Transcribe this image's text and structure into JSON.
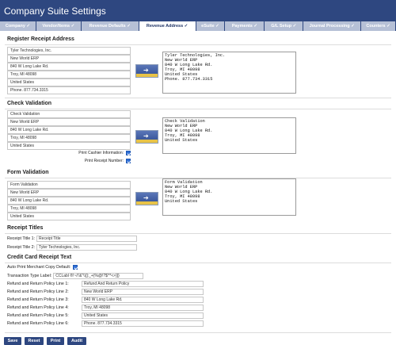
{
  "app": {
    "title": "Company Suite Settings"
  },
  "tabs": [
    {
      "label": "Company ✓"
    },
    {
      "label": "Vendor/Items ✓"
    },
    {
      "label": "Revenue Defaults ✓"
    },
    {
      "label": "Revenue Address ✓",
      "active": true
    },
    {
      "label": "eSuite ✓"
    },
    {
      "label": "Payments ✓"
    },
    {
      "label": "G/L Setup ✓"
    },
    {
      "label": "Journal Processing ✓"
    },
    {
      "label": "Counters ✓"
    }
  ],
  "register": {
    "title": "Register Receipt Address",
    "fields": [
      "Tyler Technologies, Inc.",
      "New World ERP",
      "840 W Long Lake Rd.",
      "Troy, MI 48098",
      "United States",
      "Phone. 877.734.3315"
    ],
    "preview": "Tyler Technologies, Inc.\nNew World ERP\n840 W Long Lake Rd.\nTroy, MI 48098\nUnited States\nPhone. 877.734.3315"
  },
  "check": {
    "title": "Check Validation",
    "fields": [
      "Check Validation",
      "New World ERP",
      "840 W Long Lake Rd.",
      "Troy, MI 48098",
      "United States"
    ],
    "preview": "Check Validation\nNew World ERP\n840 W Long Lake Rd.\nTroy, MI 48098\nUnited States",
    "print_cashier_label": "Print Cashier Information:",
    "print_receipt_label": "Print Receipt Number:"
  },
  "form": {
    "title": "Form Validation",
    "fields": [
      "Form Validation",
      "New World ERP",
      "840 W Long Lake Rd.",
      "Troy, MI 48098",
      "United States"
    ],
    "preview": "Form Validation\nNew World ERP\n840 W Long Lake Rd.\nTroy, MI 48098\nUnited States"
  },
  "receipt_titles": {
    "title": "Receipt Titles",
    "label1": "Receipt Title 1:",
    "value1": "Receipt Title",
    "label2": "Receipt Title 2:",
    "value2": "Tyler Technologies, Inc."
  },
  "credit_card": {
    "title": "Credit Card Receipt Text",
    "auto_print_label": "Auto Print Merchant Copy Default:",
    "transaction_label": "Transaction Type Label:",
    "transaction_value": "CCLabl ®!~/\\'&\"\\\\[]:_+{%@!?$^*<>}]}",
    "policy_lines": [
      {
        "label": "Refund and Return Policy Line 1:",
        "value": "Refund And Return Policy"
      },
      {
        "label": "Refund and Return Policy Line 2:",
        "value": "New World ERP"
      },
      {
        "label": "Refund and Return Policy Line 3:",
        "value": "840 W Long Lake Rd."
      },
      {
        "label": "Refund and Return Policy Line 4:",
        "value": "Troy, MI 48098"
      },
      {
        "label": "Refund and Return Policy Line 5:",
        "value": "United States"
      },
      {
        "label": "Refund and Return Policy Line 6:",
        "value": "Phone. 877.734.3315"
      }
    ]
  },
  "buttons": {
    "save": "Save",
    "reset": "Reset",
    "print": "Print",
    "audit": "Audit"
  },
  "icons": {
    "copy": "arrow-right-icon",
    "checkbox": "checkbox-checked-icon"
  },
  "colors": {
    "header": "#2e4780",
    "tab_inactive": "#b6c0d6",
    "checkbox": "#2f6fd6",
    "copy_strip": "#e8c347"
  }
}
